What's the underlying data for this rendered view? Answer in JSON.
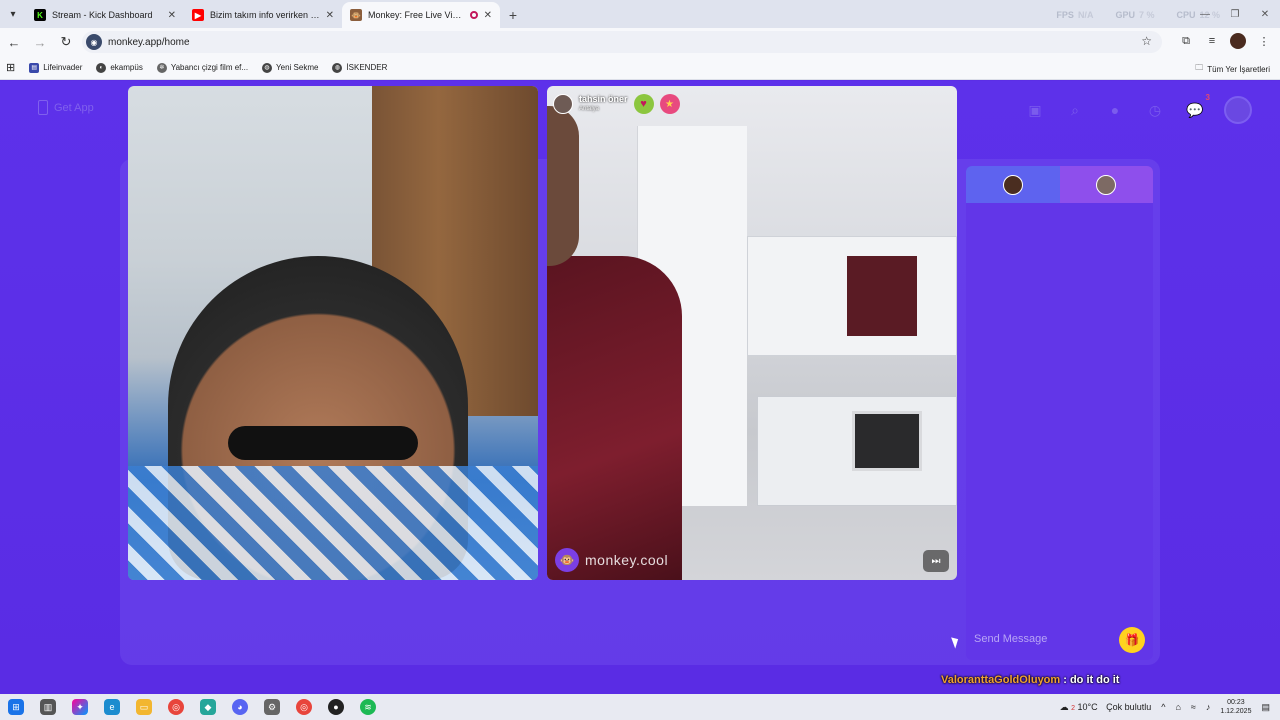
{
  "browser": {
    "tabs": [
      {
        "title": "Stream - Kick Dashboard",
        "icon": "kick-icon",
        "color": "#53fc18"
      },
      {
        "title": "Bizim takım info verirken #valo",
        "icon": "youtube-icon",
        "color": "#ff0000"
      },
      {
        "title": "Monkey: Free Live Video Ch",
        "icon": "monkey-icon",
        "color": "#8b5e3c",
        "active": true
      }
    ],
    "perf": {
      "fps_label": "FPS",
      "fps_value": "N/A",
      "gpu_label": "GPU",
      "gpu_value": "7 %",
      "cpu_label": "CPU",
      "cpu_value": "12 %"
    },
    "url": "monkey.app/home",
    "bookmarks": [
      "Lifeinvader",
      "ekampüs",
      "Yabancı çizgi film ef...",
      "Yeni Sekme",
      "İSKENDER"
    ],
    "bookmarks_folder": "Tüm Yer İşaretleri"
  },
  "page": {
    "get_app_label": "Get App",
    "notification_count": "3",
    "remote_user": {
      "name": "tahsin öner",
      "location": "Antalya"
    },
    "watermark": "monkey.cool",
    "chat_placeholder": "Send Message"
  },
  "overlay_chat": {
    "user": "ValoranttaGoldOluyom",
    "message": " : do it do it"
  },
  "taskbar": {
    "weather": "10°C",
    "weather_desc": "Çok bulutlu",
    "weather_badge": "2",
    "time": "00:23",
    "date": "1.12.2025"
  },
  "colors": {
    "page_bg": "#5b2ee6",
    "accent_gift": "#ffd21f",
    "overlay_name": "#f0a030"
  }
}
